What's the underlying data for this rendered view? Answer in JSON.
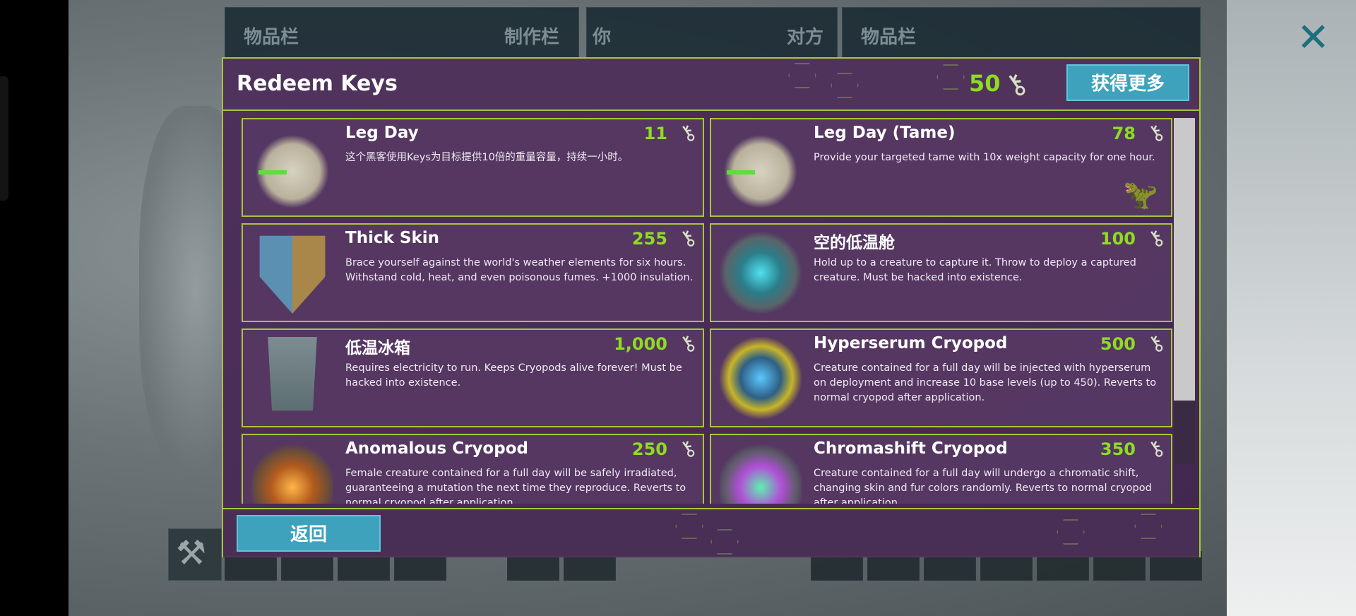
{
  "top_tabs": {
    "inventory_left": "物品栏",
    "crafting": "制作栏",
    "you": "你",
    "other": "对方",
    "inventory_right": "物品栏"
  },
  "modal": {
    "title": "Redeem Keys",
    "key_balance": "50",
    "get_more_label": "获得更多",
    "back_label": "返回"
  },
  "items": [
    {
      "name": "Leg Day",
      "cost": "11",
      "desc": "这个黑客使用Keys为目标提供10倍的重量容量，持续一小时。",
      "icon": "leg-day-icon"
    },
    {
      "name": "Leg Day (Tame)",
      "cost": "78",
      "desc": "Provide your targeted tame with 10x weight capacity for one hour.",
      "icon": "leg-day-icon"
    },
    {
      "name": "Thick Skin",
      "cost": "255",
      "desc": "Brace yourself against the world's weather elements for six hours. Withstand cold, heat, and even poisonous fumes. +1000 insulation.",
      "icon": "shield-icon"
    },
    {
      "name": "空的低温舱",
      "cost": "100",
      "desc": "Hold up to a creature to capture it. Throw to deploy a captured creature. Must be hacked into existence.",
      "icon": "cryopod-icon"
    },
    {
      "name": "低温冰箱",
      "cost": "1,000",
      "desc": "Requires electricity to run.  Keeps Cryopods alive forever! Must be hacked into existence.",
      "icon": "cryofridge-icon"
    },
    {
      "name": "Hyperserum Cryopod",
      "cost": "500",
      "desc": "Creature contained for a full day will be injected with hyperserum on deployment and increase 10 base levels (up to 450). Reverts to normal cryopod after application.",
      "icon": "hyperserum-cryopod-icon"
    },
    {
      "name": "Anomalous Cryopod",
      "cost": "250",
      "desc": "Female creature contained for a full day will be safely irradiated, guaranteeing a mutation the next time they reproduce. Reverts to normal cryopod after application.",
      "icon": "anomalous-cryopod-icon"
    },
    {
      "name": "Chromashift Cryopod",
      "cost": "350",
      "desc": "Creature contained for a full day will undergo a chromatic shift, changing skin and fur colors randomly. Reverts to normal cryopod after application.",
      "icon": "chromashift-cryopod-icon"
    }
  ],
  "colors": {
    "accent_border": "#a7c63a",
    "cost_green": "#8fdc21",
    "button_blue": "#3ea2bd",
    "panel_purple": "#4b2d57"
  },
  "scroll_position_fraction": 0.0
}
